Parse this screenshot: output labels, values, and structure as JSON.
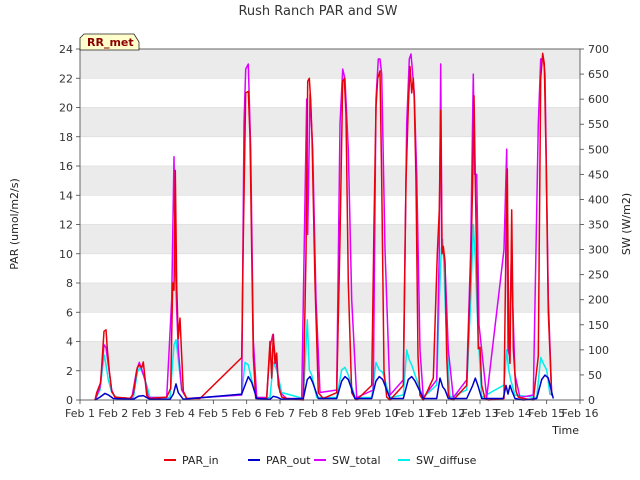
{
  "chart_data": {
    "type": "line",
    "title": "Rush Ranch PAR and SW",
    "xlabel": "Time",
    "ylabel_left": "PAR (umol/m2/s)",
    "ylabel_right": "SW (W/m2)",
    "badge": "RR_met",
    "x_ticks": [
      "Feb 1",
      "Feb 2",
      "Feb 3",
      "Feb 4",
      "Feb 5",
      "Feb 6",
      "Feb 7",
      "Feb 8",
      "Feb 9",
      "Feb 10",
      "Feb 11",
      "Feb 12",
      "Feb 13",
      "Feb 14",
      "Feb 15",
      "Feb 16"
    ],
    "xlim": [
      1,
      16
    ],
    "ylim_left": [
      0,
      24
    ],
    "ylim_right": [
      0,
      700
    ],
    "y_ticks_left": [
      0,
      2,
      4,
      6,
      8,
      10,
      12,
      14,
      16,
      18,
      20,
      22,
      24
    ],
    "y_ticks_right": [
      0,
      50,
      100,
      150,
      200,
      250,
      300,
      350,
      400,
      450,
      500,
      550,
      600,
      650,
      700
    ],
    "grid": true,
    "legend_position": "bottom",
    "colors": {
      "PAR_in": "#e8000b",
      "PAR_out": "#0000cd",
      "SW_total": "#dd00ff",
      "SW_diffuse": "#00eeee",
      "band": "#ebebeb",
      "badge_bg": "#ffffcc"
    },
    "series": [
      {
        "name": "PAR_in",
        "axis": "left",
        "x": [
          1.45,
          1.5,
          1.62,
          1.72,
          1.78,
          1.82,
          1.88,
          1.95,
          2.05,
          2.5,
          2.6,
          2.72,
          2.78,
          2.85,
          2.9,
          2.95,
          3.0,
          3.1,
          3.6,
          3.72,
          3.78,
          3.82,
          3.86,
          3.9,
          3.95,
          4.0,
          4.05,
          4.1,
          4.2,
          4.6,
          5.85,
          5.9,
          5.97,
          6.05,
          6.1,
          6.2,
          6.27,
          6.35,
          6.6,
          6.7,
          6.75,
          6.8,
          6.85,
          6.9,
          6.95,
          7.05,
          7.2,
          7.7,
          7.78,
          7.83,
          7.88,
          7.92,
          7.96,
          8.05,
          8.15,
          8.3,
          8.7,
          8.8,
          8.88,
          8.93,
          8.98,
          9.05,
          9.15,
          9.25,
          9.3,
          9.75,
          9.82,
          9.88,
          9.93,
          10.0,
          10.05,
          10.12,
          10.2,
          10.3,
          10.7,
          10.78,
          10.85,
          10.9,
          10.95,
          11.0,
          11.03,
          11.08,
          11.14,
          11.2,
          11.3,
          11.6,
          11.72,
          11.78,
          11.82,
          11.86,
          11.9,
          11.95,
          12.0,
          12.05,
          12.1,
          12.2,
          12.6,
          12.72,
          12.78,
          12.82,
          12.86,
          12.9,
          12.95,
          13.0,
          13.05,
          13.15,
          13.25,
          13.72,
          13.78,
          13.82,
          13.86,
          13.9,
          13.95,
          14.0,
          14.08,
          14.15,
          14.3,
          14.6,
          14.75,
          14.82,
          14.88,
          14.93,
          14.98,
          15.05,
          15.15
        ],
        "values": [
          0.0,
          0.5,
          1.2,
          4.7,
          4.8,
          3.5,
          2.0,
          0.6,
          0.2,
          0.1,
          0.4,
          2.2,
          2.4,
          2.2,
          2.6,
          1.5,
          0.3,
          0.1,
          0.2,
          0.8,
          8.0,
          7.5,
          15.7,
          7.8,
          4.2,
          5.6,
          3.0,
          0.6,
          0.1,
          0.1,
          2.9,
          11.0,
          21.0,
          21.1,
          18.0,
          3.0,
          0.1,
          0.1,
          0.1,
          4.0,
          1.5,
          4.5,
          2.5,
          3.2,
          1.0,
          0.2,
          0.1,
          0.0,
          10.0,
          21.8,
          22.0,
          20.5,
          18.0,
          8.0,
          0.5,
          0.1,
          0.5,
          11.0,
          21.8,
          22.0,
          19.5,
          8.0,
          0.5,
          0.1,
          0.0,
          1.0,
          12.0,
          20.0,
          22.0,
          22.5,
          15.0,
          2.0,
          0.2,
          0.0,
          1.0,
          15.0,
          20.0,
          22.8,
          21.0,
          22.0,
          20.5,
          15.0,
          3.0,
          0.3,
          0.0,
          1.5,
          10.0,
          13.0,
          19.8,
          10.0,
          10.5,
          9.5,
          3.0,
          0.4,
          0.1,
          0.0,
          1.0,
          9.0,
          15.0,
          20.8,
          15.0,
          9.5,
          3.5,
          3.6,
          1.0,
          0.1,
          0.0,
          0.1,
          11.0,
          15.8,
          4.0,
          2.5,
          13.0,
          3.5,
          0.6,
          0.2,
          0.1,
          0.0,
          3.0,
          22.0,
          23.7,
          23.0,
          17.0,
          6.0,
          0.3
        ]
      },
      {
        "name": "PAR_out",
        "axis": "left",
        "x": [
          1.45,
          1.6,
          1.75,
          1.85,
          2.0,
          2.6,
          2.75,
          2.9,
          3.1,
          3.7,
          3.8,
          3.88,
          3.95,
          4.1,
          5.85,
          5.95,
          6.05,
          6.15,
          6.3,
          6.7,
          6.8,
          6.9,
          7.05,
          7.7,
          7.82,
          7.9,
          7.98,
          8.15,
          8.7,
          8.85,
          8.95,
          9.05,
          9.25,
          9.75,
          9.88,
          9.98,
          10.08,
          10.3,
          10.7,
          10.85,
          10.95,
          11.05,
          11.3,
          11.7,
          11.8,
          11.88,
          11.95,
          12.05,
          12.6,
          12.78,
          12.86,
          12.95,
          13.05,
          13.7,
          13.78,
          13.84,
          13.9,
          13.96,
          14.05,
          14.3,
          14.7,
          14.85,
          14.95,
          15.05,
          15.2
        ],
        "values": [
          0.0,
          0.2,
          0.45,
          0.35,
          0.1,
          0.05,
          0.25,
          0.3,
          0.05,
          0.05,
          0.4,
          1.1,
          0.5,
          0.05,
          0.4,
          1.0,
          1.6,
          1.2,
          0.1,
          0.05,
          0.25,
          0.2,
          0.05,
          0.1,
          1.4,
          1.6,
          1.2,
          0.1,
          0.1,
          1.3,
          1.6,
          1.4,
          0.1,
          0.1,
          1.3,
          1.6,
          1.4,
          0.1,
          0.1,
          1.4,
          1.6,
          1.3,
          0.1,
          0.1,
          1.5,
          0.9,
          0.7,
          0.1,
          0.1,
          1.0,
          1.5,
          0.9,
          0.1,
          0.1,
          1.0,
          0.4,
          1.0,
          0.6,
          0.1,
          0.0,
          0.1,
          1.4,
          1.7,
          1.5,
          0.1
        ]
      },
      {
        "name": "SW_total",
        "axis": "right",
        "x": [
          1.45,
          1.6,
          1.72,
          1.78,
          1.85,
          1.95,
          2.05,
          2.55,
          2.7,
          2.78,
          2.88,
          2.95,
          3.05,
          3.6,
          3.75,
          3.82,
          3.86,
          3.9,
          3.95,
          4.05,
          4.2,
          5.85,
          5.92,
          5.97,
          6.05,
          6.12,
          6.2,
          6.3,
          6.6,
          6.7,
          6.78,
          6.85,
          6.92,
          7.0,
          7.2,
          7.65,
          7.75,
          7.8,
          7.83,
          7.9,
          7.98,
          8.08,
          8.2,
          8.7,
          8.8,
          8.88,
          8.95,
          9.05,
          9.15,
          9.3,
          9.8,
          9.88,
          9.95,
          10.0,
          10.05,
          10.15,
          10.3,
          10.7,
          10.8,
          10.88,
          10.93,
          10.97,
          11.03,
          11.1,
          11.2,
          11.3,
          11.7,
          11.78,
          11.82,
          11.86,
          11.9,
          11.95,
          12.05,
          12.2,
          12.6,
          12.72,
          12.8,
          12.84,
          12.9,
          12.97,
          13.05,
          13.2,
          13.72,
          13.8,
          13.84,
          13.88,
          13.94,
          14.05,
          14.2,
          14.6,
          14.75,
          14.82,
          14.9,
          14.95,
          15.05,
          15.15
        ],
        "values": [
          0.0,
          25,
          110,
          105,
          70,
          20,
          5,
          3,
          60,
          75,
          55,
          40,
          5,
          5,
          200,
          485,
          280,
          180,
          100,
          20,
          3,
          10,
          550,
          660,
          670,
          500,
          120,
          5,
          5,
          105,
          130,
          90,
          60,
          15,
          3,
          3,
          400,
          600,
          330,
          610,
          500,
          200,
          15,
          20,
          550,
          660,
          640,
          500,
          200,
          5,
          20,
          600,
          680,
          680,
          650,
          300,
          10,
          40,
          550,
          680,
          690,
          660,
          610,
          450,
          100,
          5,
          40,
          300,
          670,
          300,
          300,
          270,
          100,
          5,
          40,
          300,
          650,
          450,
          450,
          150,
          100,
          5,
          300,
          500,
          100,
          90,
          280,
          50,
          5,
          10,
          550,
          680,
          680,
          650,
          200,
          10
        ]
      },
      {
        "name": "SW_diffuse",
        "axis": "right",
        "x": [
          1.45,
          1.6,
          1.72,
          1.78,
          1.85,
          1.95,
          2.1,
          2.6,
          2.72,
          2.8,
          2.9,
          3.0,
          3.1,
          3.7,
          3.82,
          3.88,
          3.95,
          4.05,
          4.2,
          5.85,
          5.95,
          6.05,
          6.15,
          6.3,
          6.7,
          6.8,
          6.9,
          7.05,
          7.7,
          7.82,
          7.88,
          7.95,
          8.1,
          8.7,
          8.85,
          8.95,
          9.05,
          9.25,
          9.75,
          9.88,
          9.98,
          10.08,
          10.3,
          10.7,
          10.8,
          10.88,
          10.95,
          11.05,
          11.3,
          11.7,
          11.78,
          11.84,
          11.88,
          11.92,
          11.98,
          12.1,
          12.6,
          12.72,
          12.8,
          12.86,
          12.93,
          13.05,
          13.72,
          13.8,
          13.86,
          13.92,
          14.05,
          14.7,
          14.82,
          14.92,
          15.0,
          15.1
        ],
        "values": [
          0.0,
          20,
          90,
          70,
          40,
          15,
          5,
          3,
          55,
          65,
          50,
          30,
          5,
          5,
          110,
          120,
          80,
          20,
          3,
          10,
          75,
          70,
          40,
          5,
          5,
          75,
          60,
          15,
          3,
          160,
          60,
          50,
          5,
          5,
          60,
          65,
          50,
          5,
          5,
          75,
          60,
          55,
          5,
          10,
          100,
          80,
          70,
          50,
          5,
          30,
          200,
          300,
          320,
          260,
          150,
          5,
          20,
          200,
          350,
          280,
          150,
          5,
          30,
          100,
          60,
          40,
          10,
          5,
          85,
          70,
          60,
          10
        ]
      }
    ]
  }
}
